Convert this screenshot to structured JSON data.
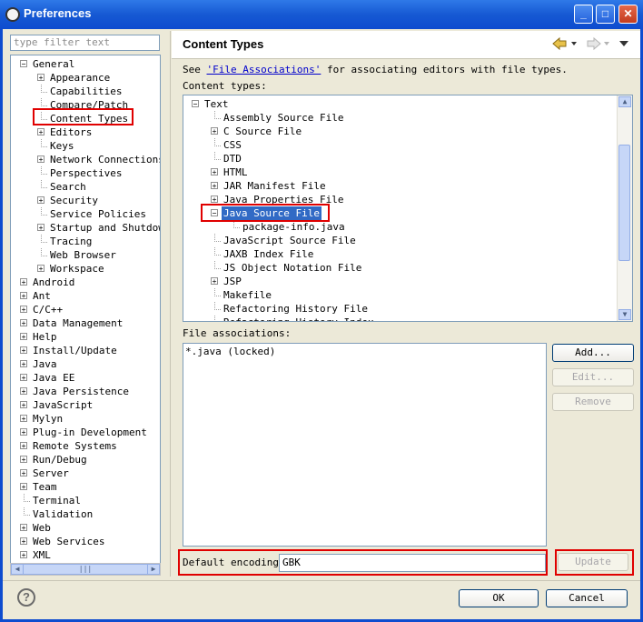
{
  "window": {
    "title": "Preferences"
  },
  "filter": {
    "placeholder": "type filter text"
  },
  "nav_tree": [
    {
      "label": "General",
      "level": 0,
      "expander": "minus"
    },
    {
      "label": "Appearance",
      "level": 1,
      "expander": "plus"
    },
    {
      "label": "Capabilities",
      "level": 1,
      "expander": ""
    },
    {
      "label": "Compare/Patch",
      "level": 1,
      "expander": ""
    },
    {
      "label": "Content Types",
      "level": 1,
      "expander": "",
      "selected": true
    },
    {
      "label": "Editors",
      "level": 1,
      "expander": "plus"
    },
    {
      "label": "Keys",
      "level": 1,
      "expander": ""
    },
    {
      "label": "Network Connections",
      "level": 1,
      "expander": "plus"
    },
    {
      "label": "Perspectives",
      "level": 1,
      "expander": ""
    },
    {
      "label": "Search",
      "level": 1,
      "expander": ""
    },
    {
      "label": "Security",
      "level": 1,
      "expander": "plus"
    },
    {
      "label": "Service Policies",
      "level": 1,
      "expander": ""
    },
    {
      "label": "Startup and Shutdown",
      "level": 1,
      "expander": "plus"
    },
    {
      "label": "Tracing",
      "level": 1,
      "expander": ""
    },
    {
      "label": "Web Browser",
      "level": 1,
      "expander": ""
    },
    {
      "label": "Workspace",
      "level": 1,
      "expander": "plus"
    },
    {
      "label": "Android",
      "level": 0,
      "expander": "plus"
    },
    {
      "label": "Ant",
      "level": 0,
      "expander": "plus"
    },
    {
      "label": "C/C++",
      "level": 0,
      "expander": "plus"
    },
    {
      "label": "Data Management",
      "level": 0,
      "expander": "plus"
    },
    {
      "label": "Help",
      "level": 0,
      "expander": "plus"
    },
    {
      "label": "Install/Update",
      "level": 0,
      "expander": "plus"
    },
    {
      "label": "Java",
      "level": 0,
      "expander": "plus"
    },
    {
      "label": "Java EE",
      "level": 0,
      "expander": "plus"
    },
    {
      "label": "Java Persistence",
      "level": 0,
      "expander": "plus"
    },
    {
      "label": "JavaScript",
      "level": 0,
      "expander": "plus"
    },
    {
      "label": "Mylyn",
      "level": 0,
      "expander": "plus"
    },
    {
      "label": "Plug-in Development",
      "level": 0,
      "expander": "plus"
    },
    {
      "label": "Remote Systems",
      "level": 0,
      "expander": "plus"
    },
    {
      "label": "Run/Debug",
      "level": 0,
      "expander": "plus"
    },
    {
      "label": "Server",
      "level": 0,
      "expander": "plus"
    },
    {
      "label": "Team",
      "level": 0,
      "expander": "plus"
    },
    {
      "label": "Terminal",
      "level": 0,
      "expander": ""
    },
    {
      "label": "Validation",
      "level": 0,
      "expander": ""
    },
    {
      "label": "Web",
      "level": 0,
      "expander": "plus"
    },
    {
      "label": "Web Services",
      "level": 0,
      "expander": "plus"
    },
    {
      "label": "XML",
      "level": 0,
      "expander": "plus"
    }
  ],
  "page": {
    "title": "Content Types",
    "see_prefix": "See ",
    "see_link": "'File Associations'",
    "see_suffix": " for associating editors with file types.",
    "content_types_label": "Content types:",
    "file_associations_label": "File associations:",
    "default_encoding_label": "Default encoding:",
    "default_encoding_value": "GBK"
  },
  "content_types": [
    {
      "label": "Text",
      "level": 0,
      "expander": "minus"
    },
    {
      "label": "Assembly Source File",
      "level": 1,
      "expander": ""
    },
    {
      "label": "C Source File",
      "level": 1,
      "expander": "plus"
    },
    {
      "label": "CSS",
      "level": 1,
      "expander": ""
    },
    {
      "label": "DTD",
      "level": 1,
      "expander": ""
    },
    {
      "label": "HTML",
      "level": 1,
      "expander": "plus"
    },
    {
      "label": "JAR Manifest File",
      "level": 1,
      "expander": "plus"
    },
    {
      "label": "Java Properties File",
      "level": 1,
      "expander": "plus"
    },
    {
      "label": "Java Source File",
      "level": 1,
      "expander": "minus",
      "selected": true
    },
    {
      "label": "package-info.java",
      "level": 2,
      "expander": ""
    },
    {
      "label": "JavaScript Source File",
      "level": 1,
      "expander": ""
    },
    {
      "label": "JAXB Index File",
      "level": 1,
      "expander": ""
    },
    {
      "label": "JS Object Notation File",
      "level": 1,
      "expander": ""
    },
    {
      "label": "JSP",
      "level": 1,
      "expander": "plus"
    },
    {
      "label": "Makefile",
      "level": 1,
      "expander": ""
    },
    {
      "label": "Refactoring History File",
      "level": 1,
      "expander": ""
    },
    {
      "label": "Refactoring History Index",
      "level": 1,
      "expander": ""
    }
  ],
  "file_associations": [
    "*.java (locked)"
  ],
  "buttons": {
    "add": "Add...",
    "edit": "Edit...",
    "remove": "Remove",
    "update": "Update",
    "ok": "OK",
    "cancel": "Cancel"
  },
  "icons": {
    "help": "help-icon",
    "back": "back-arrow-icon",
    "forward": "forward-arrow-icon",
    "menu": "view-menu-icon"
  },
  "colors": {
    "title_bar": "#0e4ccf",
    "selection": "#316ac5",
    "highlight_box": "#e00000"
  }
}
